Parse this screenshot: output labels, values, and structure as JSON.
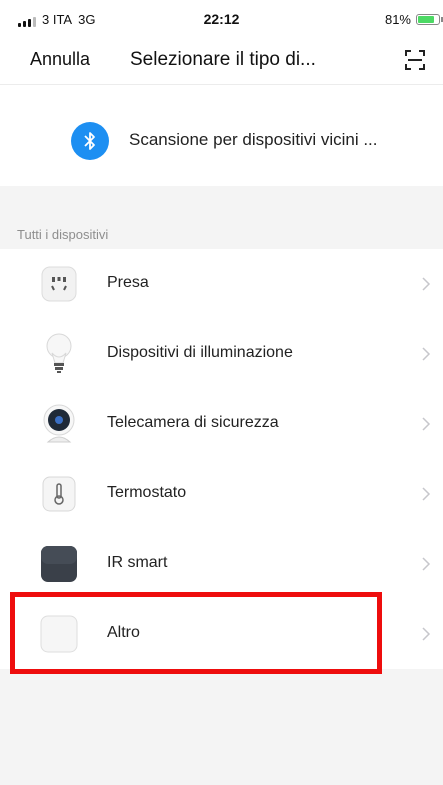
{
  "status": {
    "carrier": "3 ITA",
    "network": "3G",
    "time": "22:12",
    "battery": "81%",
    "battery_level": 0.81
  },
  "nav": {
    "cancel": "Annulla",
    "title": "Selezionare il tipo di..."
  },
  "bluetooth_scan": {
    "label": "Scansione per dispositivi vicini ..."
  },
  "section": {
    "label": "Tutti i dispositivi"
  },
  "devices": [
    {
      "label": "Presa",
      "icon": "socket-icon"
    },
    {
      "label": "Dispositivi di illuminazione",
      "icon": "light-bulb-icon"
    },
    {
      "label": "Telecamera di sicurezza",
      "icon": "security-camera-icon"
    },
    {
      "label": "Termostato",
      "icon": "thermostat-icon"
    },
    {
      "label": "IR smart",
      "icon": "ir-remote-icon"
    },
    {
      "label": "Altro",
      "icon": "other-device-icon"
    }
  ],
  "colors": {
    "bluetooth": "#1d8ff2",
    "highlight": "#ee0d0d",
    "battery": "#4cd964"
  }
}
